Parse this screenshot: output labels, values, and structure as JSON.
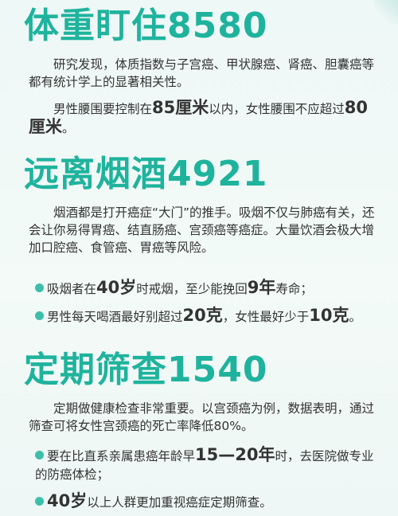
{
  "section1": {
    "title": "体重盯住8580",
    "p1": "研究发现，体质指数与子宫癌、甲状腺癌、肾癌、胆囊癌等都有统计学上的显著相关性。",
    "p2_a": "男性腰围要控制在",
    "p2_b": "85厘米",
    "p2_c": "以内，女性腰围不应超过",
    "p2_d": "80厘米",
    "p2_e": "。"
  },
  "section2": {
    "title": "远离烟酒4921",
    "p1": "烟酒都是打开癌症“大门”的推手。吸烟不仅与肺癌有关，还会让你易得胃癌、结直肠癌、宫颈癌等癌症。大量饮酒会极大增加口腔癌、食管癌、胃癌等风险。",
    "b1_a": "吸烟者在",
    "b1_b": "40岁",
    "b1_c": "时戒烟，至少能挽回",
    "b1_d": "9年",
    "b1_e": "寿命；",
    "b2_a": "男性每天喝酒最好别超过",
    "b2_b": "20克",
    "b2_c": "，女性最好少于",
    "b2_d": "10克",
    "b2_e": "。"
  },
  "section3": {
    "title": "定期筛查1540",
    "p1": "定期做健康检查非常重要。以宫颈癌为例，数据表明，通过筛查可将女性宫颈癌的死亡率降低80%。",
    "b1_a": "要在比直系亲属患癌年龄早",
    "b1_b": "15—20年",
    "b1_c": "时，去医院做专业的防癌体检；",
    "b2_a": "40岁",
    "b2_b": "以上人群更加重视癌症定期筛查。"
  }
}
